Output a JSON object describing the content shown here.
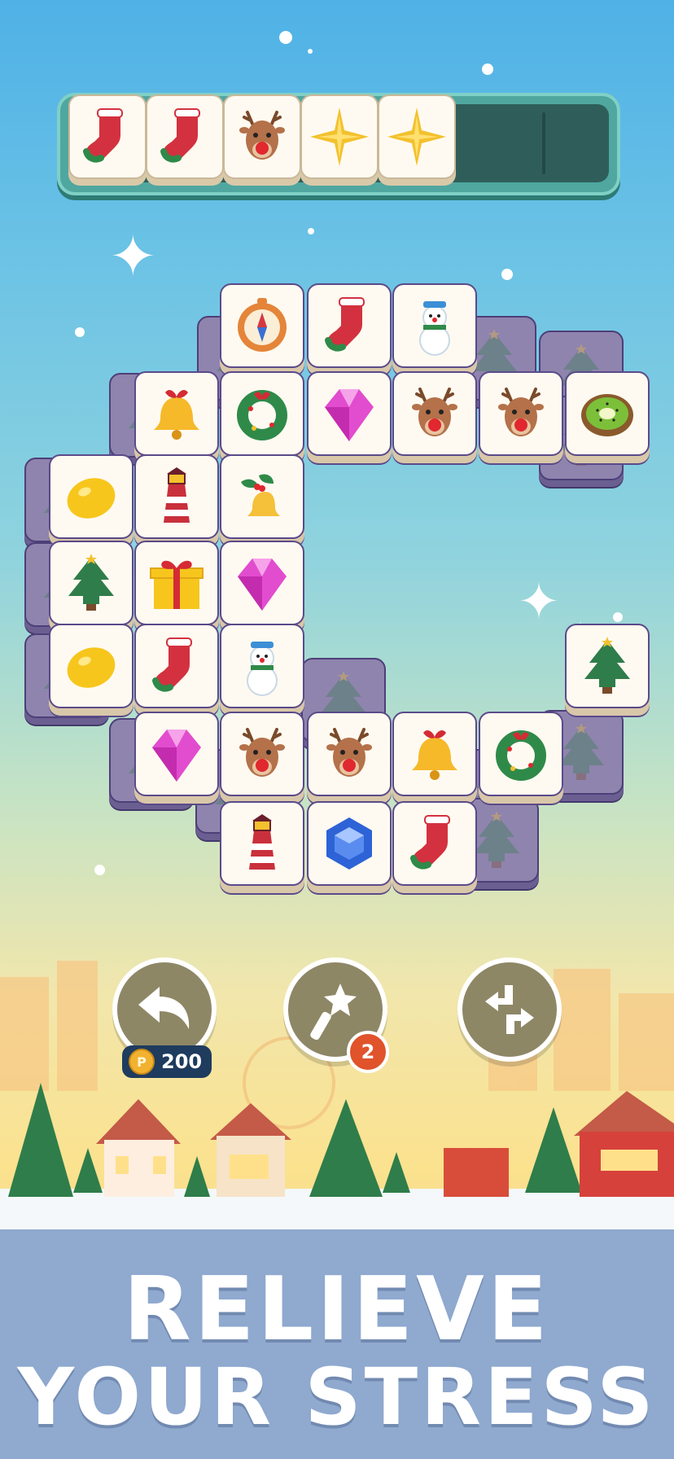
{
  "tray": {
    "slots_total": 7,
    "tiles": [
      {
        "icon": "stocking-icon"
      },
      {
        "icon": "stocking-icon"
      },
      {
        "icon": "reindeer-icon"
      },
      {
        "icon": "star-icon"
      },
      {
        "icon": "star-icon"
      }
    ]
  },
  "board": {
    "top_layer": [
      {
        "icon": "compass-icon",
        "row": 0,
        "col": 2
      },
      {
        "icon": "stocking-icon",
        "row": 0,
        "col": 3
      },
      {
        "icon": "snowman-icon",
        "row": 0,
        "col": 4
      },
      {
        "icon": "bell-icon",
        "row": 1,
        "col": 1
      },
      {
        "icon": "wreath-icon",
        "row": 1,
        "col": 2
      },
      {
        "icon": "gem-pink-icon",
        "row": 1,
        "col": 3
      },
      {
        "icon": "reindeer-icon",
        "row": 1,
        "col": 4
      },
      {
        "icon": "reindeer-icon",
        "row": 1,
        "col": 5
      },
      {
        "icon": "kiwi-icon",
        "row": 1,
        "col": 6
      },
      {
        "icon": "lemon-icon",
        "row": 2,
        "col": 0
      },
      {
        "icon": "lighthouse-icon",
        "row": 2,
        "col": 1
      },
      {
        "icon": "holly-bell-icon",
        "row": 2,
        "col": 2
      },
      {
        "icon": "tree-icon",
        "row": 3,
        "col": 0
      },
      {
        "icon": "gift-icon",
        "row": 3,
        "col": 1
      },
      {
        "icon": "gem-pink-icon",
        "row": 3,
        "col": 2
      },
      {
        "icon": "lemon-icon",
        "row": 4,
        "col": 0
      },
      {
        "icon": "stocking-icon",
        "row": 4,
        "col": 1
      },
      {
        "icon": "snowman-icon",
        "row": 4,
        "col": 2
      },
      {
        "icon": "tree-icon",
        "row": 4,
        "col": 6
      },
      {
        "icon": "gem-pink-icon",
        "row": 5,
        "col": 1
      },
      {
        "icon": "reindeer-icon",
        "row": 5,
        "col": 2
      },
      {
        "icon": "reindeer-icon",
        "row": 5,
        "col": 3
      },
      {
        "icon": "bell-icon",
        "row": 5,
        "col": 4
      },
      {
        "icon": "wreath-icon",
        "row": 5,
        "col": 5
      },
      {
        "icon": "lighthouse-icon",
        "row": 6,
        "col": 2
      },
      {
        "icon": "gem-blue-icon",
        "row": 6,
        "col": 3
      },
      {
        "icon": "stocking-icon",
        "row": 6,
        "col": 4
      }
    ]
  },
  "tools": {
    "undo": {
      "icon": "undo-arrow-icon",
      "cost": "200",
      "currency_icon": "coin-icon",
      "currency_letter": "P"
    },
    "magic": {
      "icon": "magic-wand-icon",
      "count": "2"
    },
    "shuffle": {
      "icon": "shuffle-icon"
    }
  },
  "banner": {
    "line1": "RELIEVE",
    "line2": "YOUR STRESS"
  },
  "colors": {
    "sky_top": "#4fb1e6",
    "sky_bottom": "#fbe28f",
    "tile_face": "#fffaf1",
    "tile_border": "#5b4a89",
    "tray": "#4fa7a0",
    "banner": "#8fa9cf"
  }
}
